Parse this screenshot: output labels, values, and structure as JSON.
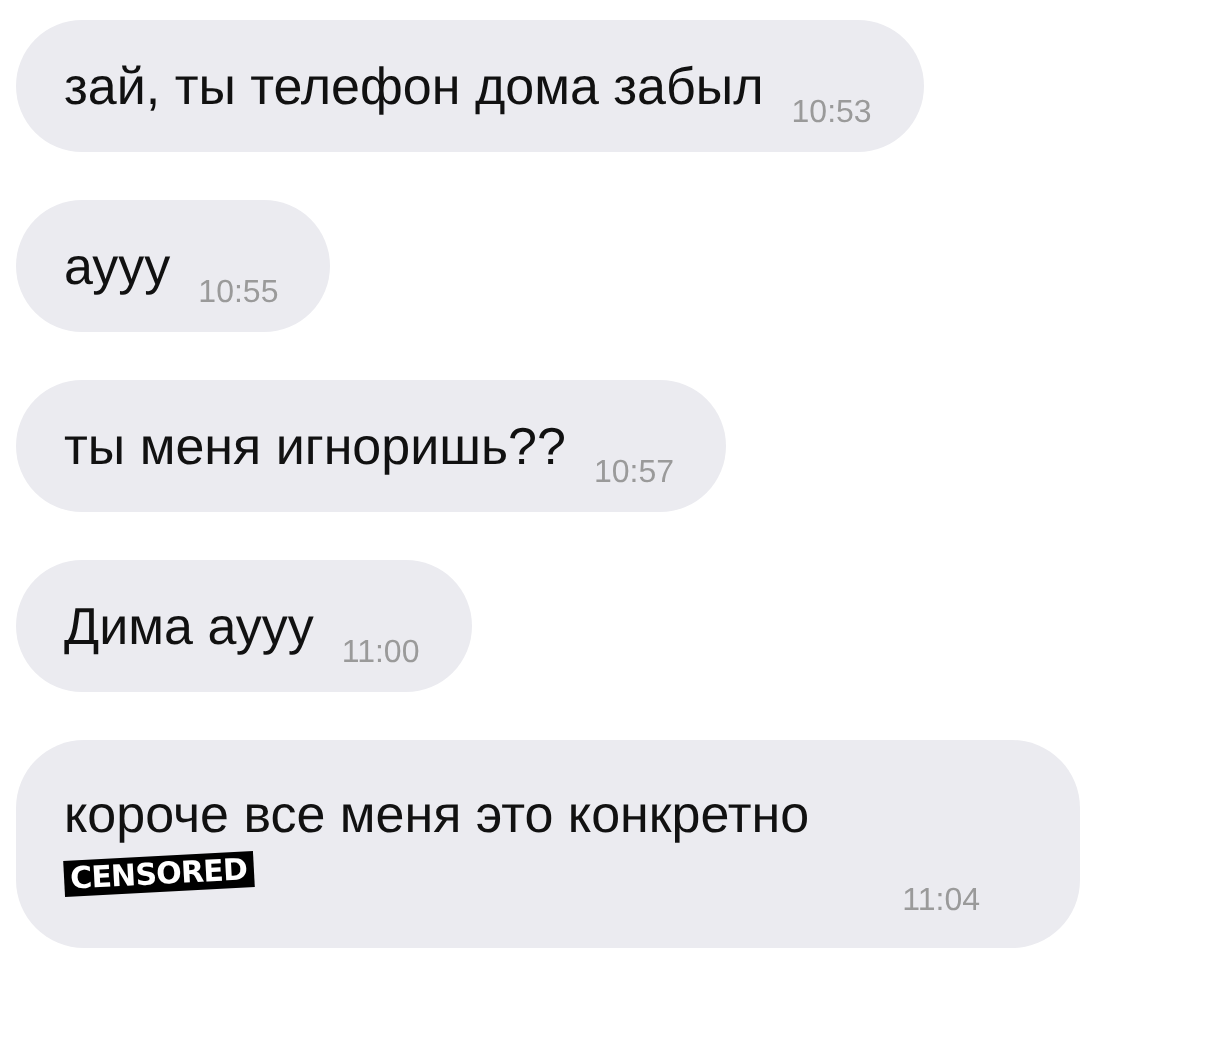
{
  "messages": [
    {
      "text": "зай, ты телефон дома забыл",
      "time": "10:53"
    },
    {
      "text": "аууу",
      "time": "10:55"
    },
    {
      "text": "ты меня игноришь??",
      "time": "10:57"
    },
    {
      "text": "Дима аууу",
      "time": "11:00"
    },
    {
      "text": "короче все меня это конкретно",
      "time": "11:04",
      "censor_label": "CENSORED"
    }
  ]
}
